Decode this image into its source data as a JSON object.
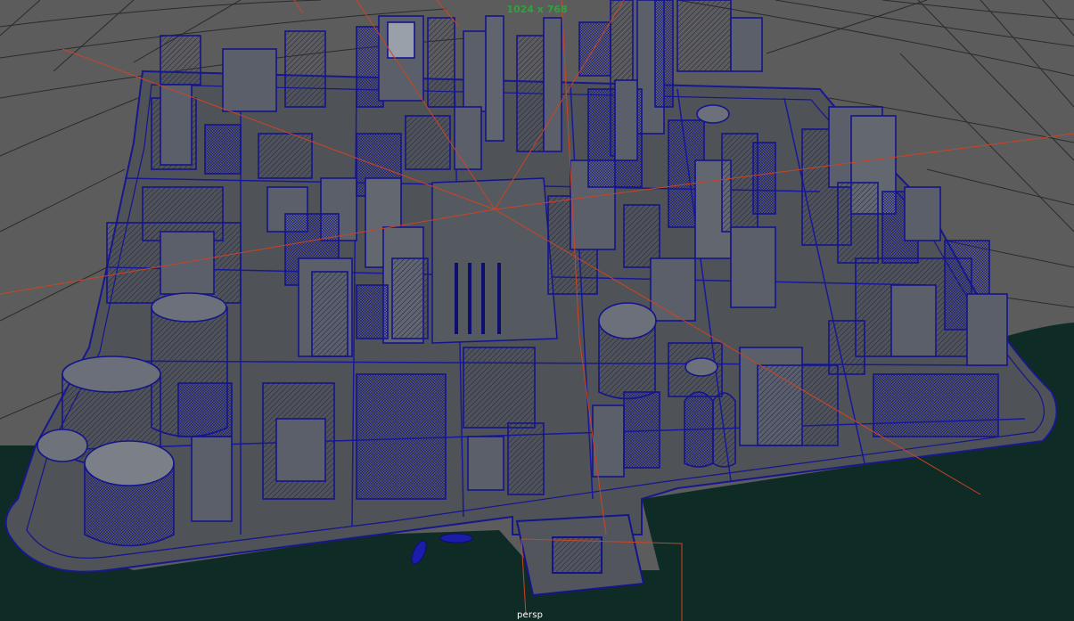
{
  "viewport": {
    "resolution_gate": "1024 x 768",
    "camera_name": "persp"
  },
  "colors": {
    "background": "#5c5c5c",
    "grid": "#2c2c2c",
    "water": "#0f2b25",
    "wireframe": "#14148c",
    "building_fill": "#5a5f6a",
    "ground_fill": "#4f5257",
    "camera_frustum": "#cc4422",
    "gate_text": "#2fa33a"
  },
  "icons": [
    "camera-frustum",
    "city-wireframe"
  ]
}
